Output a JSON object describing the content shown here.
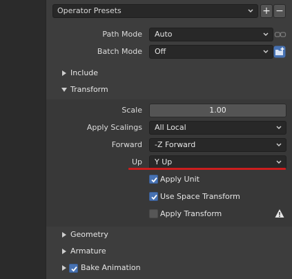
{
  "presets": {
    "label": "Operator Presets",
    "add": "+",
    "remove": "−"
  },
  "path_mode": {
    "label": "Path Mode",
    "value": "Auto"
  },
  "batch_mode": {
    "label": "Batch Mode",
    "value": "Off"
  },
  "sections": {
    "include": "Include",
    "transform": "Transform",
    "geometry": "Geometry",
    "armature": "Armature",
    "bake_animation": "Bake Animation"
  },
  "transform": {
    "scale": {
      "label": "Scale",
      "value": "1.00"
    },
    "apply_scalings": {
      "label": "Apply Scalings",
      "value": "All Local"
    },
    "forward": {
      "label": "Forward",
      "value": "-Z Forward"
    },
    "up": {
      "label": "Up",
      "value": "Y Up"
    },
    "apply_unit": {
      "label": "Apply Unit",
      "checked": true
    },
    "use_space_transform": {
      "label": "Use Space Transform",
      "checked": true
    },
    "apply_transform": {
      "label": "Apply Transform",
      "checked": false
    }
  },
  "bake_animation_checked": true,
  "colors": {
    "accent": "#4772b3",
    "highlight_line": "#cc1e1e",
    "panel": "#3d3d3d"
  },
  "icons": [
    "chevron-down-icon",
    "plus-icon",
    "minus-icon",
    "unlink-icon",
    "new-folder-icon",
    "disclosure-triangle-icon",
    "checkmark-icon",
    "warning-icon"
  ]
}
